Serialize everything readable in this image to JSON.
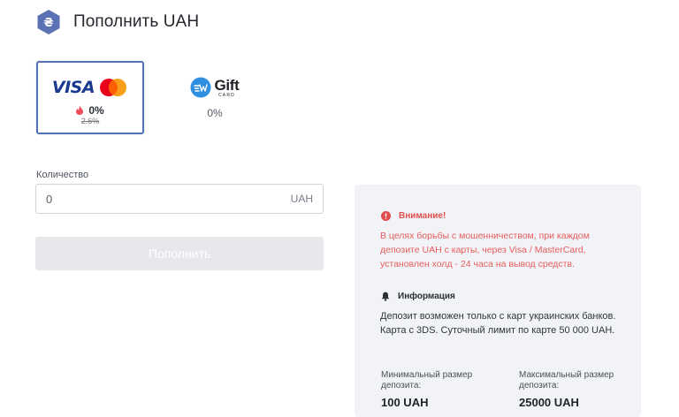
{
  "header": {
    "title": "Пополнить UAH",
    "currency_symbol": "₴"
  },
  "payment_methods": [
    {
      "name": "visa-mastercard",
      "brand": "VISA",
      "fee": "0%",
      "old_fee": "2.6%",
      "selected": true
    },
    {
      "name": "gift-card",
      "brand": "Gift",
      "brand_sub": "CARD",
      "fee": "0%",
      "selected": false
    }
  ],
  "form": {
    "quantity_label": "Количество",
    "amount_placeholder": "0",
    "amount_value": "",
    "currency": "UAH",
    "submit_label": "Пополнить"
  },
  "info": {
    "warning_title": "Внимание!",
    "warning_text": "В целях борьбы с мошенничеством, при каждом депозите UAH с карты, через Visa / MasterCard, установлен холд - 24 часа на вывод средств.",
    "info_title": "Информация",
    "info_text": "Депозит возможен только с карт украинских банков. Карта с 3DS. Суточный лимит по карте 50 000 UAH.",
    "min_label": "Минимальный размер депозита:",
    "min_value": "100 UAH",
    "max_label": "Максимальный размер депозита:",
    "max_value": "25000 UAH"
  },
  "colors": {
    "accent": "#5272b8",
    "warning": "#e65d5d",
    "panel_bg": "#f2f3f6",
    "button_disabled": "#e6e8ec"
  }
}
